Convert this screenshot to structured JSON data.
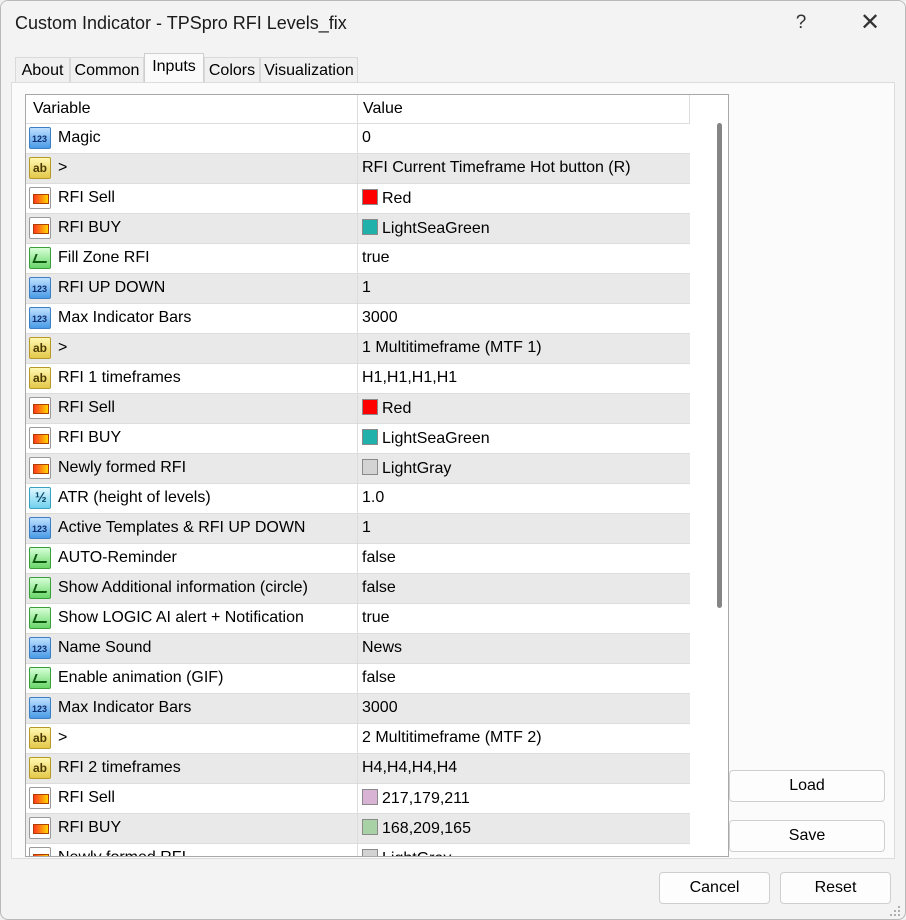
{
  "window": {
    "title": "Custom Indicator - TPSpro RFI Levels_fix",
    "help_label": "?",
    "close_label": "✕"
  },
  "tabs": [
    {
      "label": "About"
    },
    {
      "label": "Common"
    },
    {
      "label": "Inputs"
    },
    {
      "label": "Colors"
    },
    {
      "label": "Visualization"
    }
  ],
  "active_tab": "Inputs",
  "grid": {
    "headers": {
      "variable": "Variable",
      "value": "Value"
    },
    "rows": [
      {
        "icon": "int-icon",
        "name": "Magic",
        "value": "0"
      },
      {
        "icon": "string-icon",
        "name": ">",
        "value": "RFI Current Timeframe Hot button (R)"
      },
      {
        "icon": "color-icon",
        "name": "RFI Sell",
        "value": "Red",
        "swatch": "#ff0000"
      },
      {
        "icon": "color-icon",
        "name": "RFI BUY",
        "value": "LightSeaGreen",
        "swatch": "#20b2aa"
      },
      {
        "icon": "bool-icon",
        "name": "Fill Zone RFI",
        "value": "true"
      },
      {
        "icon": "int-icon",
        "name": "RFI UP DOWN",
        "value": "1"
      },
      {
        "icon": "int-icon",
        "name": "Max Indicator Bars",
        "value": "3000"
      },
      {
        "icon": "string-icon",
        "name": ">",
        "value": "1 Multitimeframe (MTF 1)"
      },
      {
        "icon": "string-icon",
        "name": "RFI 1 timeframes",
        "value": "H1,H1,H1,H1"
      },
      {
        "icon": "color-icon",
        "name": "RFI Sell",
        "value": "Red",
        "swatch": "#ff0000"
      },
      {
        "icon": "color-icon",
        "name": "RFI BUY",
        "value": "LightSeaGreen",
        "swatch": "#20b2aa"
      },
      {
        "icon": "color-icon",
        "name": "Newly formed RFI",
        "value": "LightGray",
        "swatch": "#d3d3d3"
      },
      {
        "icon": "double-icon",
        "name": "ATR (height of levels)",
        "value": "1.0"
      },
      {
        "icon": "int-icon",
        "name": "Active Templates & RFI UP DOWN",
        "value": "1"
      },
      {
        "icon": "bool-icon",
        "name": "AUTO-Reminder",
        "value": "false"
      },
      {
        "icon": "bool-icon",
        "name": "Show Additional information (circle)",
        "value": "false"
      },
      {
        "icon": "bool-icon",
        "name": "Show LOGIC AI alert + Notification",
        "value": "true"
      },
      {
        "icon": "int-icon",
        "name": "Name Sound",
        "value": "News"
      },
      {
        "icon": "bool-icon",
        "name": "Enable animation (GIF)",
        "value": "false"
      },
      {
        "icon": "int-icon",
        "name": "Max Indicator Bars",
        "value": "3000"
      },
      {
        "icon": "string-icon",
        "name": ">",
        "value": "2 Multitimeframe (MTF 2)"
      },
      {
        "icon": "string-icon",
        "name": "RFI 2 timeframes",
        "value": "H4,H4,H4,H4"
      },
      {
        "icon": "color-icon",
        "name": "RFI Sell",
        "value": "217,179,211",
        "swatch": "#d9b3d3"
      },
      {
        "icon": "color-icon",
        "name": "RFI BUY",
        "value": "168,209,165",
        "swatch": "#a8d1a5"
      },
      {
        "icon": "color-icon",
        "name": "Newly formed RFI",
        "value": "LightGray",
        "swatch": "#d3d3d3"
      }
    ]
  },
  "side_buttons": {
    "load_label": "Load",
    "save_label": "Save"
  },
  "footer_buttons": {
    "cancel_label": "Cancel",
    "reset_label": "Reset"
  }
}
